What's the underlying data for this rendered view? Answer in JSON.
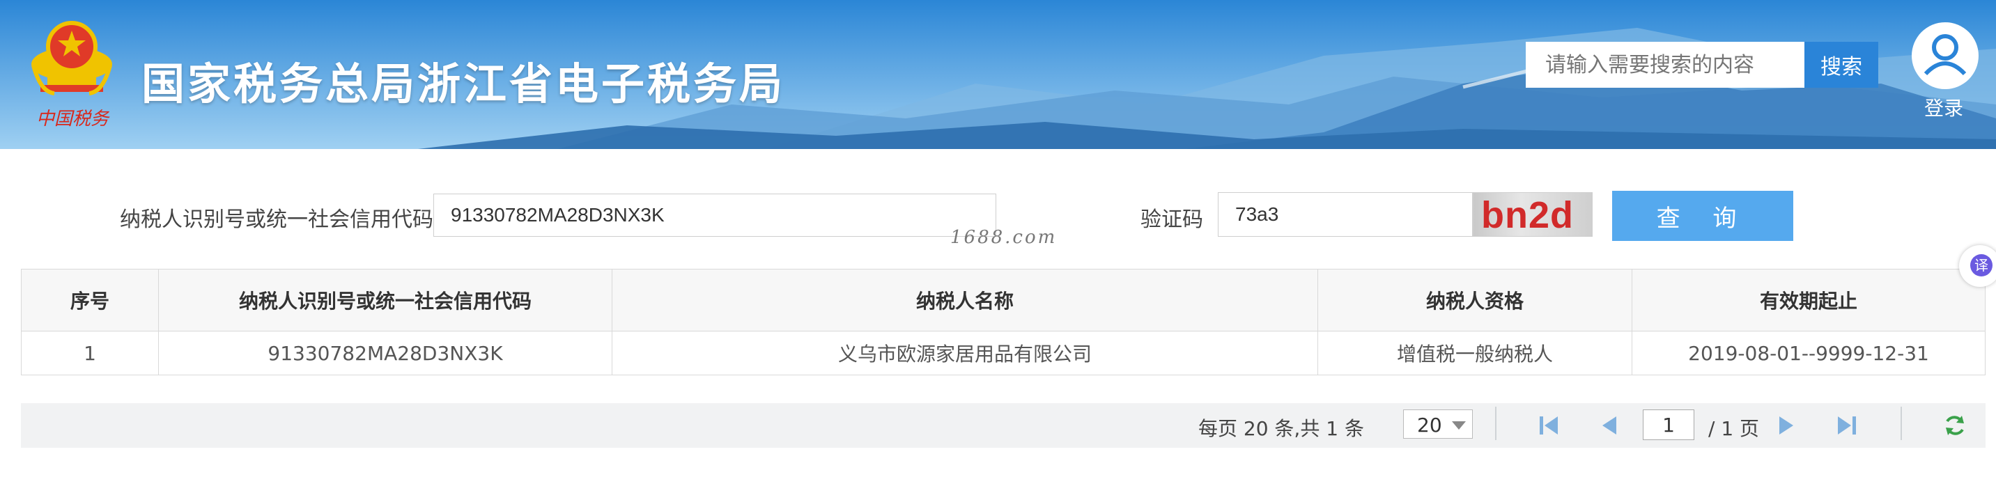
{
  "header": {
    "site_title": "国家税务总局浙江省电子税务局",
    "logo_caption": "中国税务",
    "search_placeholder": "请输入需要搜索的内容",
    "search_button": "搜索",
    "login_label": "登录"
  },
  "query_form": {
    "taxpayer_id_label": "纳税人识别号或统一社会信用代码",
    "taxpayer_id_value": "91330782MA28D3NX3K",
    "captcha_label": "验证码",
    "captcha_value": "73a3",
    "captcha_image_text": "bn2d",
    "query_button": "查 询",
    "watermark": "1688.com"
  },
  "results_table": {
    "columns": [
      "序号",
      "纳税人识别号或统一社会信用代码",
      "纳税人名称",
      "纳税人资格",
      "有效期起止"
    ],
    "rows": [
      [
        "1",
        "91330782MA28D3NX3K",
        "义乌市欧源家居用品有限公司",
        "增值税一般纳税人",
        "2019-08-01--9999-12-31"
      ]
    ]
  },
  "pagination": {
    "summary": "每页 20 条,共 1 条",
    "page_size": "20",
    "current_page": "1",
    "total_pages": "/ 1 页"
  },
  "translate_fab": {
    "glyph": "译"
  },
  "colors": {
    "header_blue": "#2f8fdc",
    "search_button": "#2a84d8",
    "query_button": "#55a9ee",
    "captcha_text": "#d12a2a"
  }
}
